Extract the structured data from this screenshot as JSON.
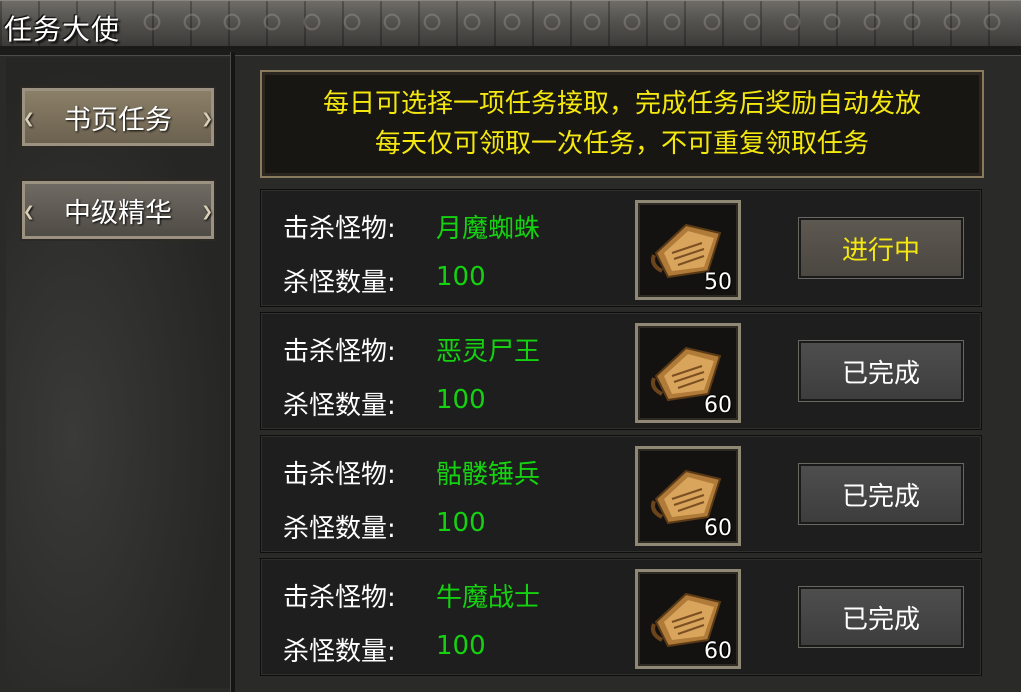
{
  "window": {
    "title": "任务大使"
  },
  "sidebar": {
    "items": [
      {
        "label": "书页任务",
        "active": true
      },
      {
        "label": "中级精华",
        "active": false
      }
    ]
  },
  "notice": {
    "line1": "每日可选择一项任务接取，完成任务后奖励自动发放",
    "line2": "每天仅可领取一次任务，不可重复领取任务"
  },
  "tasks": [
    {
      "kill_label": "击杀怪物:",
      "monster": "月魔蜘蛛",
      "count_label": "杀怪数量:",
      "count": "100",
      "reward_icon": "scroll-icon",
      "reward_qty": "50",
      "status": "进行中"
    },
    {
      "kill_label": "击杀怪物:",
      "monster": "恶灵尸王",
      "count_label": "杀怪数量:",
      "count": "100",
      "reward_icon": "scroll-icon",
      "reward_qty": "60",
      "status": "已完成"
    },
    {
      "kill_label": "击杀怪物:",
      "monster": "骷髅锤兵",
      "count_label": "杀怪数量:",
      "count": "100",
      "reward_icon": "scroll-icon",
      "reward_qty": "60",
      "status": "已完成"
    },
    {
      "kill_label": "击杀怪物:",
      "monster": "牛魔战士",
      "count_label": "杀怪数量:",
      "count": "100",
      "reward_icon": "scroll-icon",
      "reward_qty": "60",
      "status": "已完成"
    }
  ],
  "colors": {
    "notice_text": "#f4e80e",
    "monster_text": "#14d20f",
    "in_progress_text": "#f4e80e",
    "done_text": "#ffffff"
  }
}
